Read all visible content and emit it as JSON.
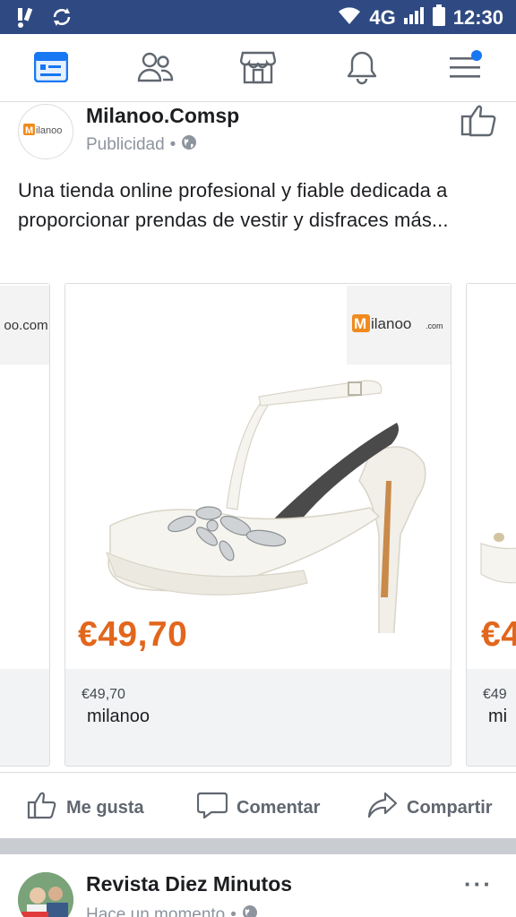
{
  "status_bar": {
    "network": "4G",
    "time": "12:30"
  },
  "nav": {
    "items": [
      {
        "name": "news-feed",
        "icon": "feed-icon",
        "active": true
      },
      {
        "name": "friends",
        "icon": "friends-icon",
        "active": false
      },
      {
        "name": "marketplace",
        "icon": "store-icon",
        "active": false
      },
      {
        "name": "notifications",
        "icon": "bell-icon",
        "active": false
      },
      {
        "name": "menu",
        "icon": "hamburger-icon",
        "active": false,
        "badge_dot": true
      }
    ],
    "accent_color": "#1877f2"
  },
  "post": {
    "page_name": "Milanoo.Comsp",
    "sponsored_label": "Publicidad",
    "separator": "•",
    "privacy_icon": "globe-icon",
    "text": "Una tienda online profesional y fiable dedicada a proporcionar prendas de vestir y disfraces más...",
    "avatar_logo_text": "Milanoo",
    "carousel": {
      "left_partial_logo": "oo.com",
      "main_card": {
        "logo_text": "Milanoo",
        "logo_suffix": ".com",
        "price_overlay": "€49,70",
        "price": "€49,70",
        "seller": "milanoo"
      },
      "right_partial_card": {
        "price_overlay": "€4",
        "price": "€49",
        "seller": "mi"
      },
      "price_color": "#e2661c"
    },
    "actions": {
      "like": "Me gusta",
      "comment": "Comentar",
      "share": "Compartir"
    }
  },
  "next_post": {
    "page_name": "Revista Diez Minutos",
    "time": "Hace un momento",
    "separator": "•",
    "more": "···"
  }
}
